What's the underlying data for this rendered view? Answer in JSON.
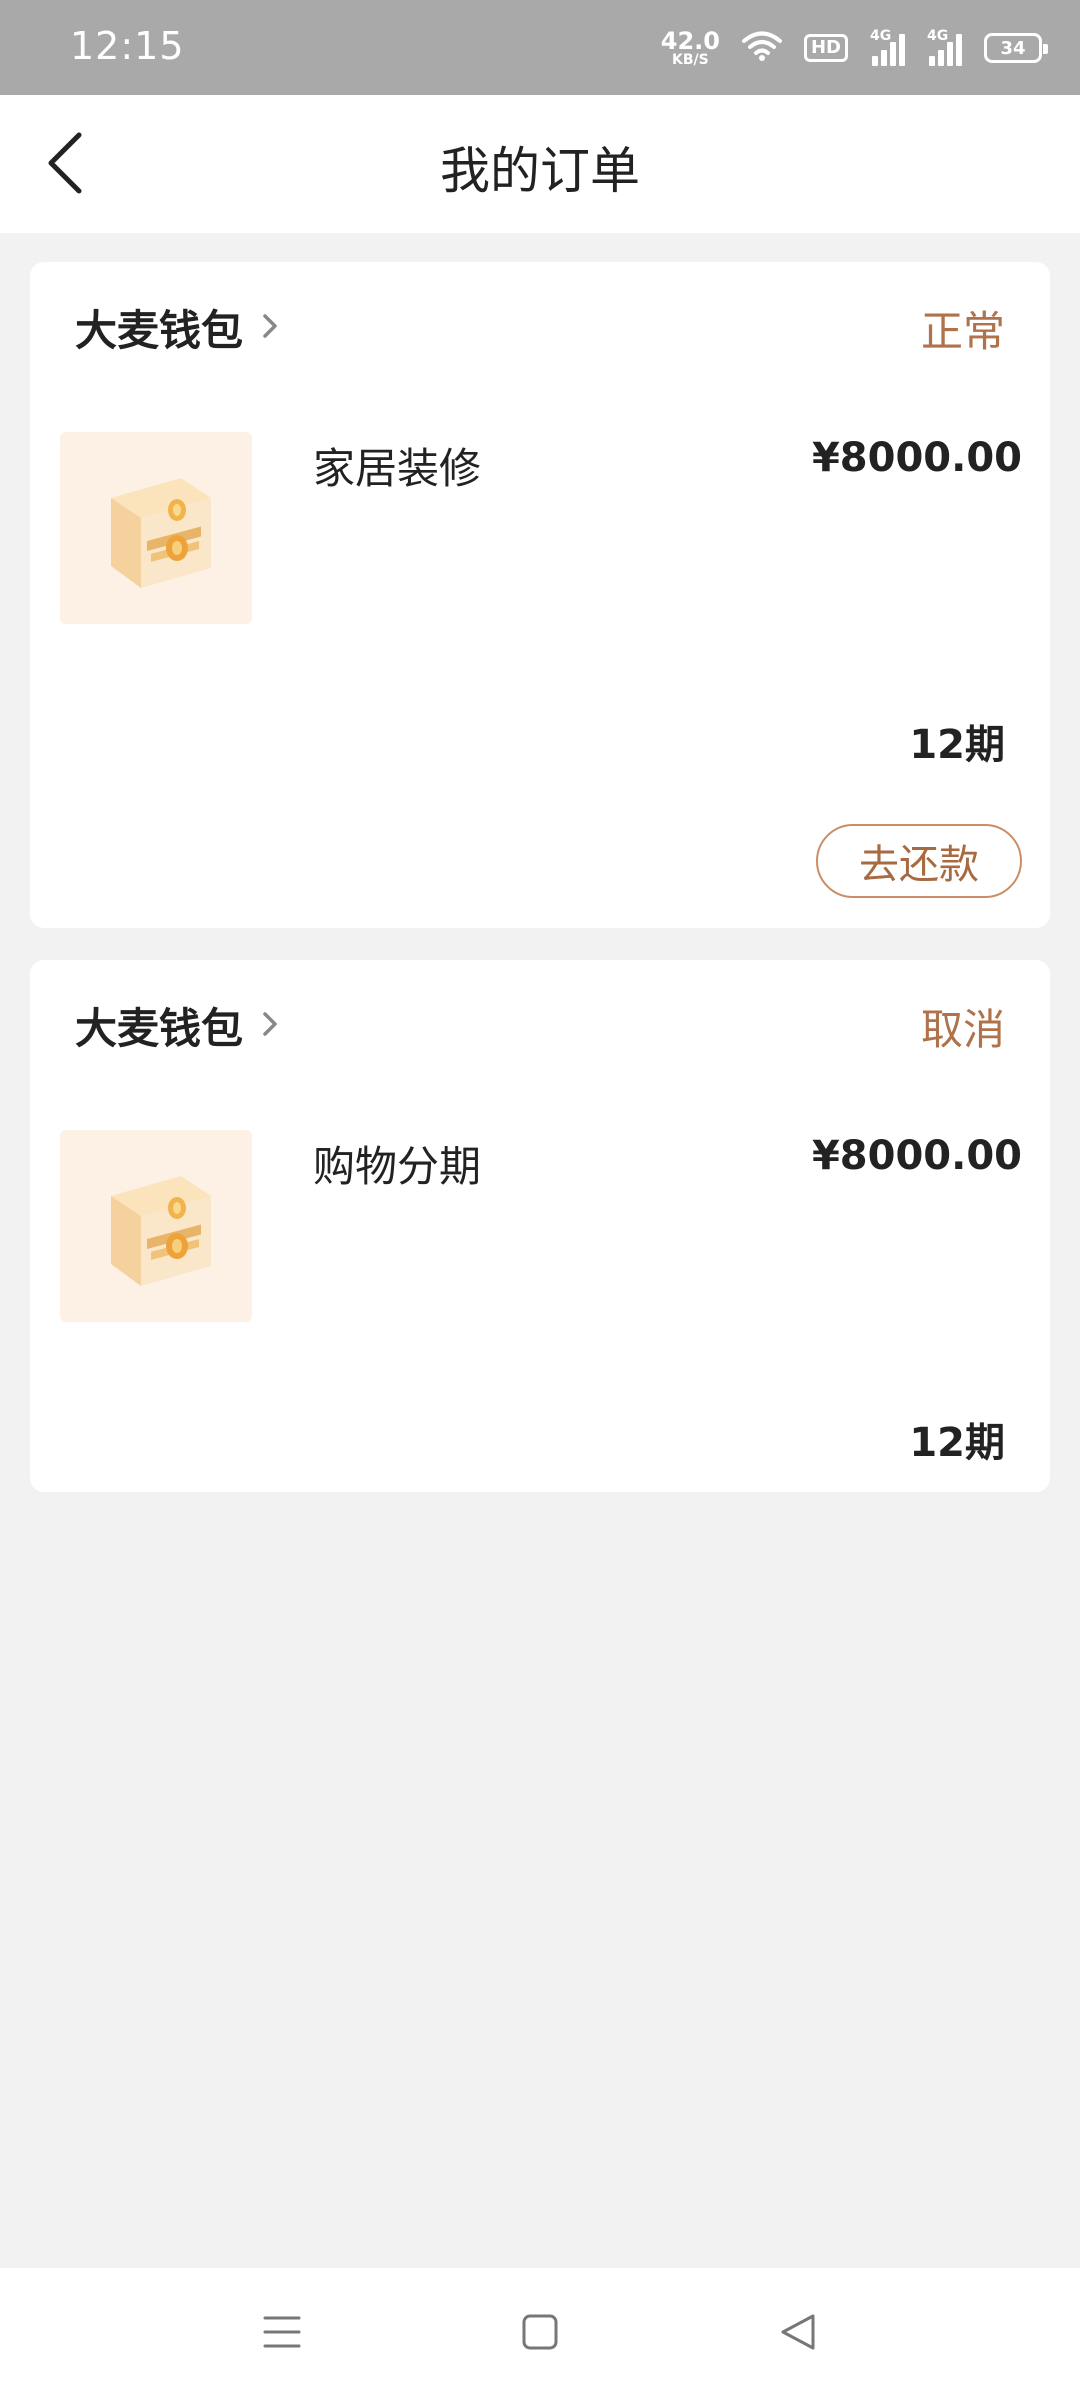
{
  "status_bar": {
    "time": "12:15",
    "net_speed_value": "42.0",
    "net_speed_unit": "KB/S",
    "hd_label": "HD",
    "signal_1_label": "4G",
    "signal_2_label": "4G",
    "battery_level": "34"
  },
  "header": {
    "title": "我的订单",
    "back_icon": "chevron-left-icon"
  },
  "orders": [
    {
      "merchant": "大麦钱包",
      "status": "正常",
      "product_name": "家居装修",
      "price": "¥8000.00",
      "installments": "12期",
      "action_label": "去还款"
    },
    {
      "merchant": "大麦钱包",
      "status": "取消",
      "product_name": "购物分期",
      "price": "¥8000.00",
      "installments": "12期"
    }
  ],
  "nav_bar": {
    "menu_icon": "menu-icon",
    "home_icon": "home-icon",
    "back_icon": "back-triangle-icon"
  },
  "colors": {
    "status_accent": "#b0724a",
    "button_border": "#c98e66",
    "page_background": "#f2f2f2",
    "status_bar_background": "#a9a9a9"
  }
}
